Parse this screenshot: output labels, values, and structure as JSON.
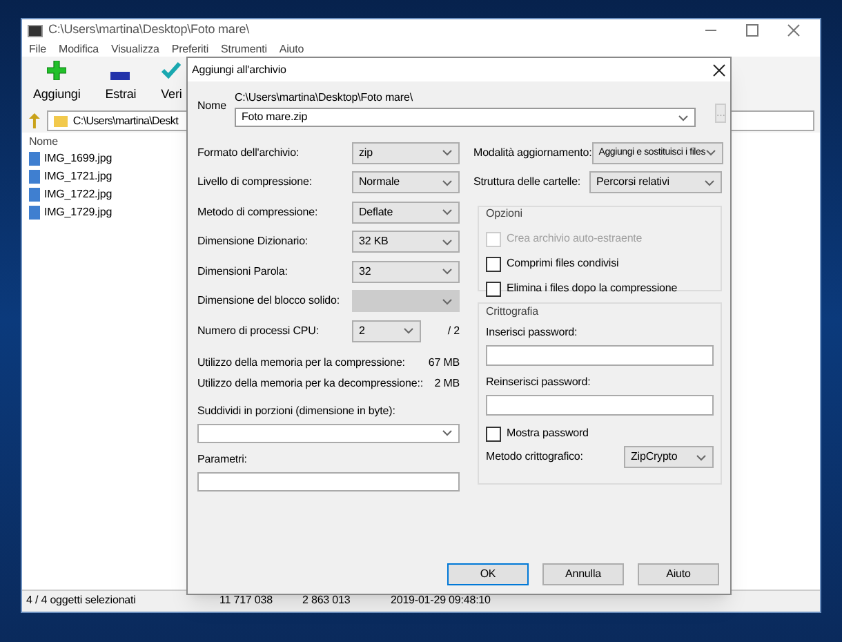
{
  "main_window": {
    "title": "C:\\Users\\martina\\Desktop\\Foto mare\\",
    "menu": [
      "File",
      "Modifica",
      "Visualizza",
      "Preferiti",
      "Strumenti",
      "Aiuto"
    ],
    "toolbar": [
      {
        "label": "Aggiungi",
        "kind": "add"
      },
      {
        "label": "Estrai",
        "kind": "extract"
      },
      {
        "label": "Veri",
        "kind": "test"
      }
    ],
    "address": "C:\\Users\\martina\\Deskt",
    "column": "Nome",
    "files": [
      "IMG_1699.jpg",
      "IMG_1721.jpg",
      "IMG_1722.jpg",
      "IMG_1729.jpg"
    ],
    "status_bar": [
      "4 / 4 oggetti selezionati",
      "11 717 038",
      "2 863 013",
      "2019-01-29 09:48:10"
    ]
  },
  "dialog": {
    "title": "Aggiungi all'archivio",
    "name_label": "Nome",
    "path": "C:\\Users\\martina\\Desktop\\Foto mare\\",
    "archive_name": "Foto mare.zip",
    "browse_button": "...",
    "settings": [
      {
        "label": "Formato dell'archivio:",
        "value": "zip",
        "disabled": false
      },
      {
        "label": "Livello di compressione:",
        "value": "Normale",
        "disabled": false
      },
      {
        "label": "Metodo di compressione:",
        "value": "Deflate",
        "disabled": false
      },
      {
        "label": "Dimensione Dizionario:",
        "value": "32 KB",
        "disabled": false
      },
      {
        "label": "Dimensioni Parola:",
        "value": "32",
        "disabled": false
      },
      {
        "label": "Dimensione del blocco solido:",
        "disabled": true
      }
    ],
    "cpu": {
      "label": "Numero di processi CPU:",
      "value": "2",
      "max": "/ 2"
    },
    "memory": [
      {
        "label": "Utilizzo della memoria per la compressione:",
        "value": "67 MB"
      },
      {
        "label": "Utilizzo della memoria per ka decompressione::",
        "value": "2 MB"
      }
    ],
    "split_label": "Suddividi in porzioni (dimensione in byte):",
    "params_label": "Parametri:",
    "update_mode": {
      "label": "Modalità aggiornamento:",
      "value": "Aggiungi e sostituisci i files"
    },
    "path_mode": {
      "label": "Struttura delle cartelle:",
      "value": "Percorsi relativi"
    },
    "options": {
      "title": "Opzioni",
      "items": [
        {
          "label": "Crea archivio auto-estraente",
          "checked": false,
          "disabled": true
        },
        {
          "label": "Comprimi files condivisi",
          "checked": false,
          "disabled": false
        },
        {
          "label": "Elimina i files dopo la compressione",
          "checked": false,
          "disabled": false
        }
      ]
    },
    "encryption": {
      "title": "Crittografia",
      "password_label": "Inserisci password:",
      "repeat_label": "Reinserisci password:",
      "show_password": {
        "label": "Mostra password",
        "checked": false
      },
      "method_label": "Metodo crittografico:",
      "method": "ZipCrypto"
    },
    "buttons": [
      {
        "label": "OK",
        "default": true
      },
      {
        "label": "Annulla",
        "default": false
      },
      {
        "label": "Aiuto",
        "default": false
      }
    ]
  }
}
